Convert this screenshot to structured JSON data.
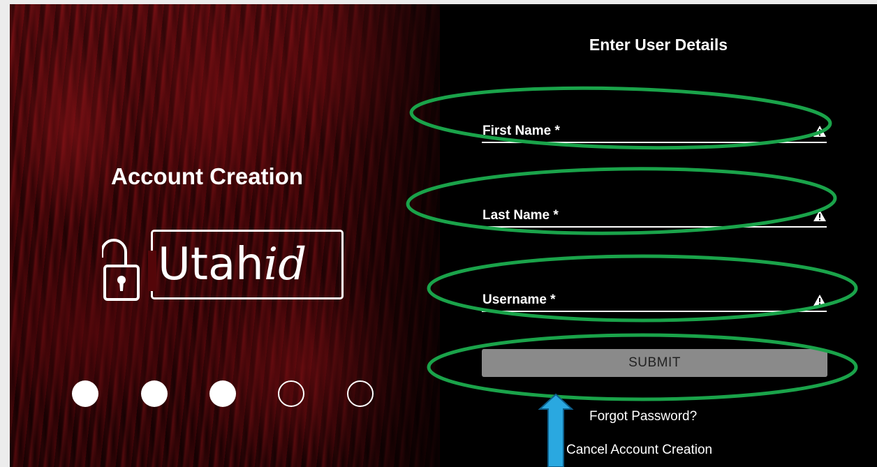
{
  "left": {
    "title": "Account Creation",
    "logo": {
      "text_main": "Utah",
      "text_italic": "id"
    },
    "progress_dots": [
      {
        "state": "filled"
      },
      {
        "state": "filled"
      },
      {
        "state": "filled"
      },
      {
        "state": "empty"
      },
      {
        "state": "empty"
      }
    ]
  },
  "form": {
    "title": "Enter User Details",
    "fields": [
      {
        "label": "First Name *",
        "icon": "warning-icon"
      },
      {
        "label": "Last Name *",
        "icon": "warning-icon"
      },
      {
        "label": "Username *",
        "icon": "warning-icon"
      }
    ],
    "submit_label": "SUBMIT",
    "forgot_password": "Forgot Password?",
    "cancel": "Cancel Account Creation"
  },
  "annotations": {
    "highlight_color": "#1aa34a",
    "arrow_color": "#2aa8e0"
  },
  "colors": {
    "panel_background": "#000000",
    "button_gray": "#8a8a8a",
    "canyon_red": "#6a0c10"
  }
}
